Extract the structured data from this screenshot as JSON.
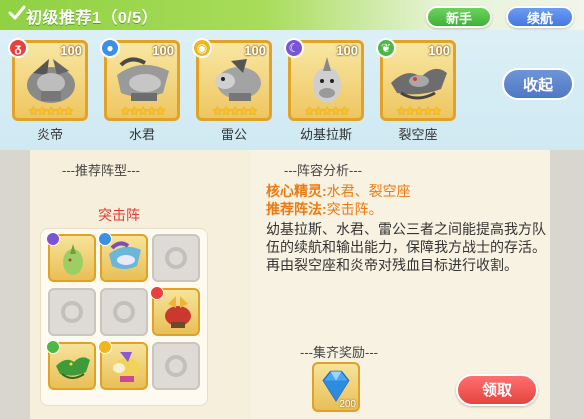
{
  "header": {
    "title": "初级推荐1（0/5）",
    "btn_xinshou": "新手",
    "btn_xuhang": "续航",
    "collapse": "收起"
  },
  "team": [
    {
      "name": "炎帝",
      "level": "100",
      "element": "fire",
      "color": "#e8413b",
      "stars": "★★★★★"
    },
    {
      "name": "水君",
      "level": "100",
      "element": "water",
      "color": "#3b8fe6",
      "stars": "★★★★★"
    },
    {
      "name": "雷公",
      "level": "100",
      "element": "electric",
      "color": "#f0b61c",
      "stars": "★★★★★"
    },
    {
      "name": "幼基拉斯",
      "level": "100",
      "element": "psychic",
      "color": "#7b54d6",
      "stars": "★★★★★"
    },
    {
      "name": "裂空座",
      "level": "100",
      "element": "grass",
      "color": "#4cb845",
      "stars": "★★★★★"
    }
  ],
  "formation": {
    "section_title": "---推荐阵型---",
    "name": "突击阵"
  },
  "analysis": {
    "section_title": "---阵容分析---",
    "core_label": "核心精灵:",
    "core_value": "水君、裂空座",
    "method_label": "推荐阵法:",
    "method_value": "突击阵。",
    "description": "幼基拉斯、水君、雷公三者之间能提高我方队伍的续航和输出能力，保障我方战士的存活。再由裂空座和炎帝对残血目标进行收割。"
  },
  "reward": {
    "section_title": "---集齐奖励---",
    "count": "200",
    "claim": "领取"
  }
}
